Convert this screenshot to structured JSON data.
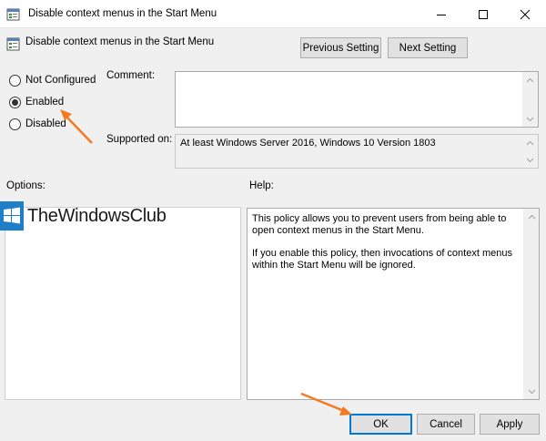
{
  "window": {
    "title": "Disable context menus in the Start Menu",
    "icon": "policy-settings-icon"
  },
  "header": {
    "policy_name": "Disable context menus in the Start Menu",
    "previous_label": "Previous Setting",
    "next_label": "Next Setting"
  },
  "state": {
    "options": [
      {
        "label": "Not Configured",
        "selected": false
      },
      {
        "label": "Enabled",
        "selected": true
      },
      {
        "label": "Disabled",
        "selected": false
      }
    ]
  },
  "comment": {
    "label": "Comment:",
    "value": ""
  },
  "supported": {
    "label": "Supported on:",
    "value": "At least Windows Server 2016, Windows 10 Version 1803"
  },
  "options_panel": {
    "label": "Options:"
  },
  "help_panel": {
    "label": "Help:",
    "paragraphs": [
      "This policy allows you to prevent users from being able to open context menus in the Start Menu.",
      "If you enable this policy, then invocations of context menus within the Start Menu will be ignored."
    ]
  },
  "footer": {
    "ok_label": "OK",
    "cancel_label": "Cancel",
    "apply_label": "Apply"
  },
  "watermark": {
    "text": "TheWindowsClub"
  },
  "colors": {
    "annotation_arrow": "#f47a20",
    "focus_blue": "#0078d7"
  }
}
